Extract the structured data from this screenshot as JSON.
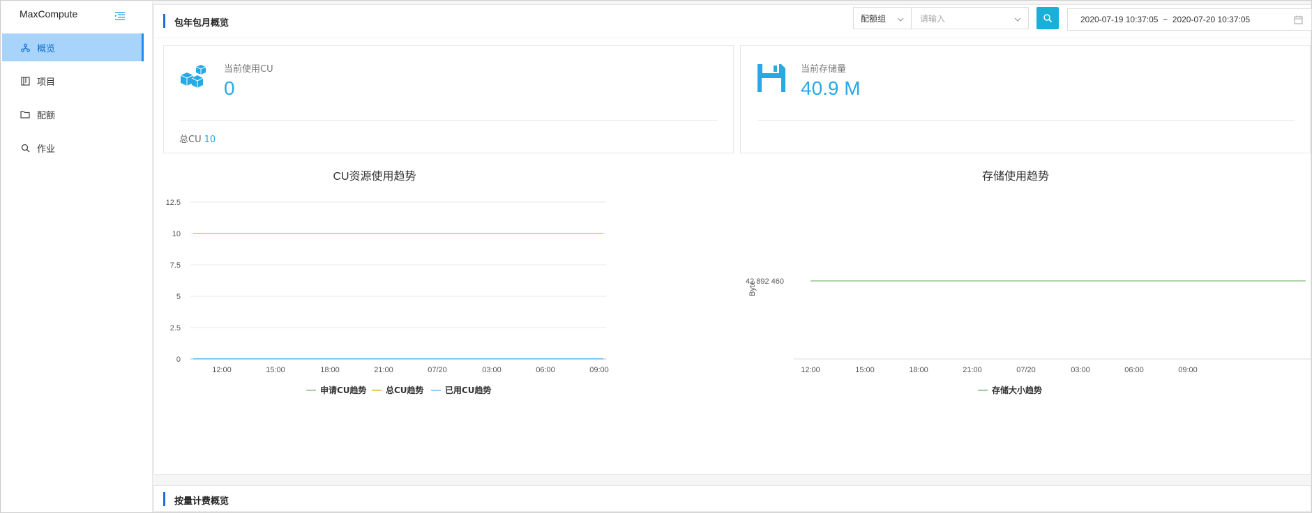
{
  "app": {
    "title": "MaxCompute"
  },
  "sidebar": {
    "items": [
      {
        "label": "概览",
        "icon": "cluster-icon",
        "active": true
      },
      {
        "label": "项目",
        "icon": "project-icon",
        "active": false
      },
      {
        "label": "配额",
        "icon": "folder-icon",
        "active": false
      },
      {
        "label": "作业",
        "icon": "search-icon",
        "active": false
      }
    ]
  },
  "header": {
    "title": "包年包月概览",
    "select_value": "配额组",
    "input_placeholder": "请输入",
    "date_range": "2020-07-19 10:37:05  ~  2020-07-20 10:37:05"
  },
  "cards": {
    "cu": {
      "label": "当前使用CU",
      "value": "0",
      "foot_label": "总CU",
      "foot_value": "10"
    },
    "storage": {
      "label": "当前存储量",
      "value": "40.9 M"
    }
  },
  "colors": {
    "accent": "#29a8e6",
    "primary": "#17b1d8",
    "active_bg": "#a8d4fb"
  },
  "chart_data": [
    {
      "type": "line",
      "title": "CU资源使用趋势",
      "ylim": [
        0,
        12.5
      ],
      "yticks": [
        "12.5",
        "10",
        "7.5",
        "5",
        "2.5",
        "0"
      ],
      "xticks": [
        "12:00",
        "15:00",
        "18:00",
        "21:00",
        "07/20",
        "03:00",
        "06:00",
        "09:00"
      ],
      "series": [
        {
          "name": "申请CU趋势",
          "color": "#8fbc8f",
          "values": [
            0,
            0
          ]
        },
        {
          "name": "总CU趋势",
          "color": "#e6b422",
          "values": [
            10,
            10
          ]
        },
        {
          "name": "已用CU趋势",
          "color": "#6fc3e8",
          "values": [
            0,
            0
          ]
        }
      ]
    },
    {
      "type": "line",
      "title": "存储使用趋势",
      "ylabel": "Byte",
      "ytick": "42 892 460",
      "xticks": [
        "12:00",
        "15:00",
        "18:00",
        "21:00",
        "07/20",
        "03:00",
        "06:00",
        "09:00"
      ],
      "series": [
        {
          "name": "存储大小趋势",
          "color": "#7cb87c",
          "values": [
            42892460,
            42892460
          ]
        }
      ]
    }
  ],
  "bottom": {
    "title": "按量计费概览"
  }
}
